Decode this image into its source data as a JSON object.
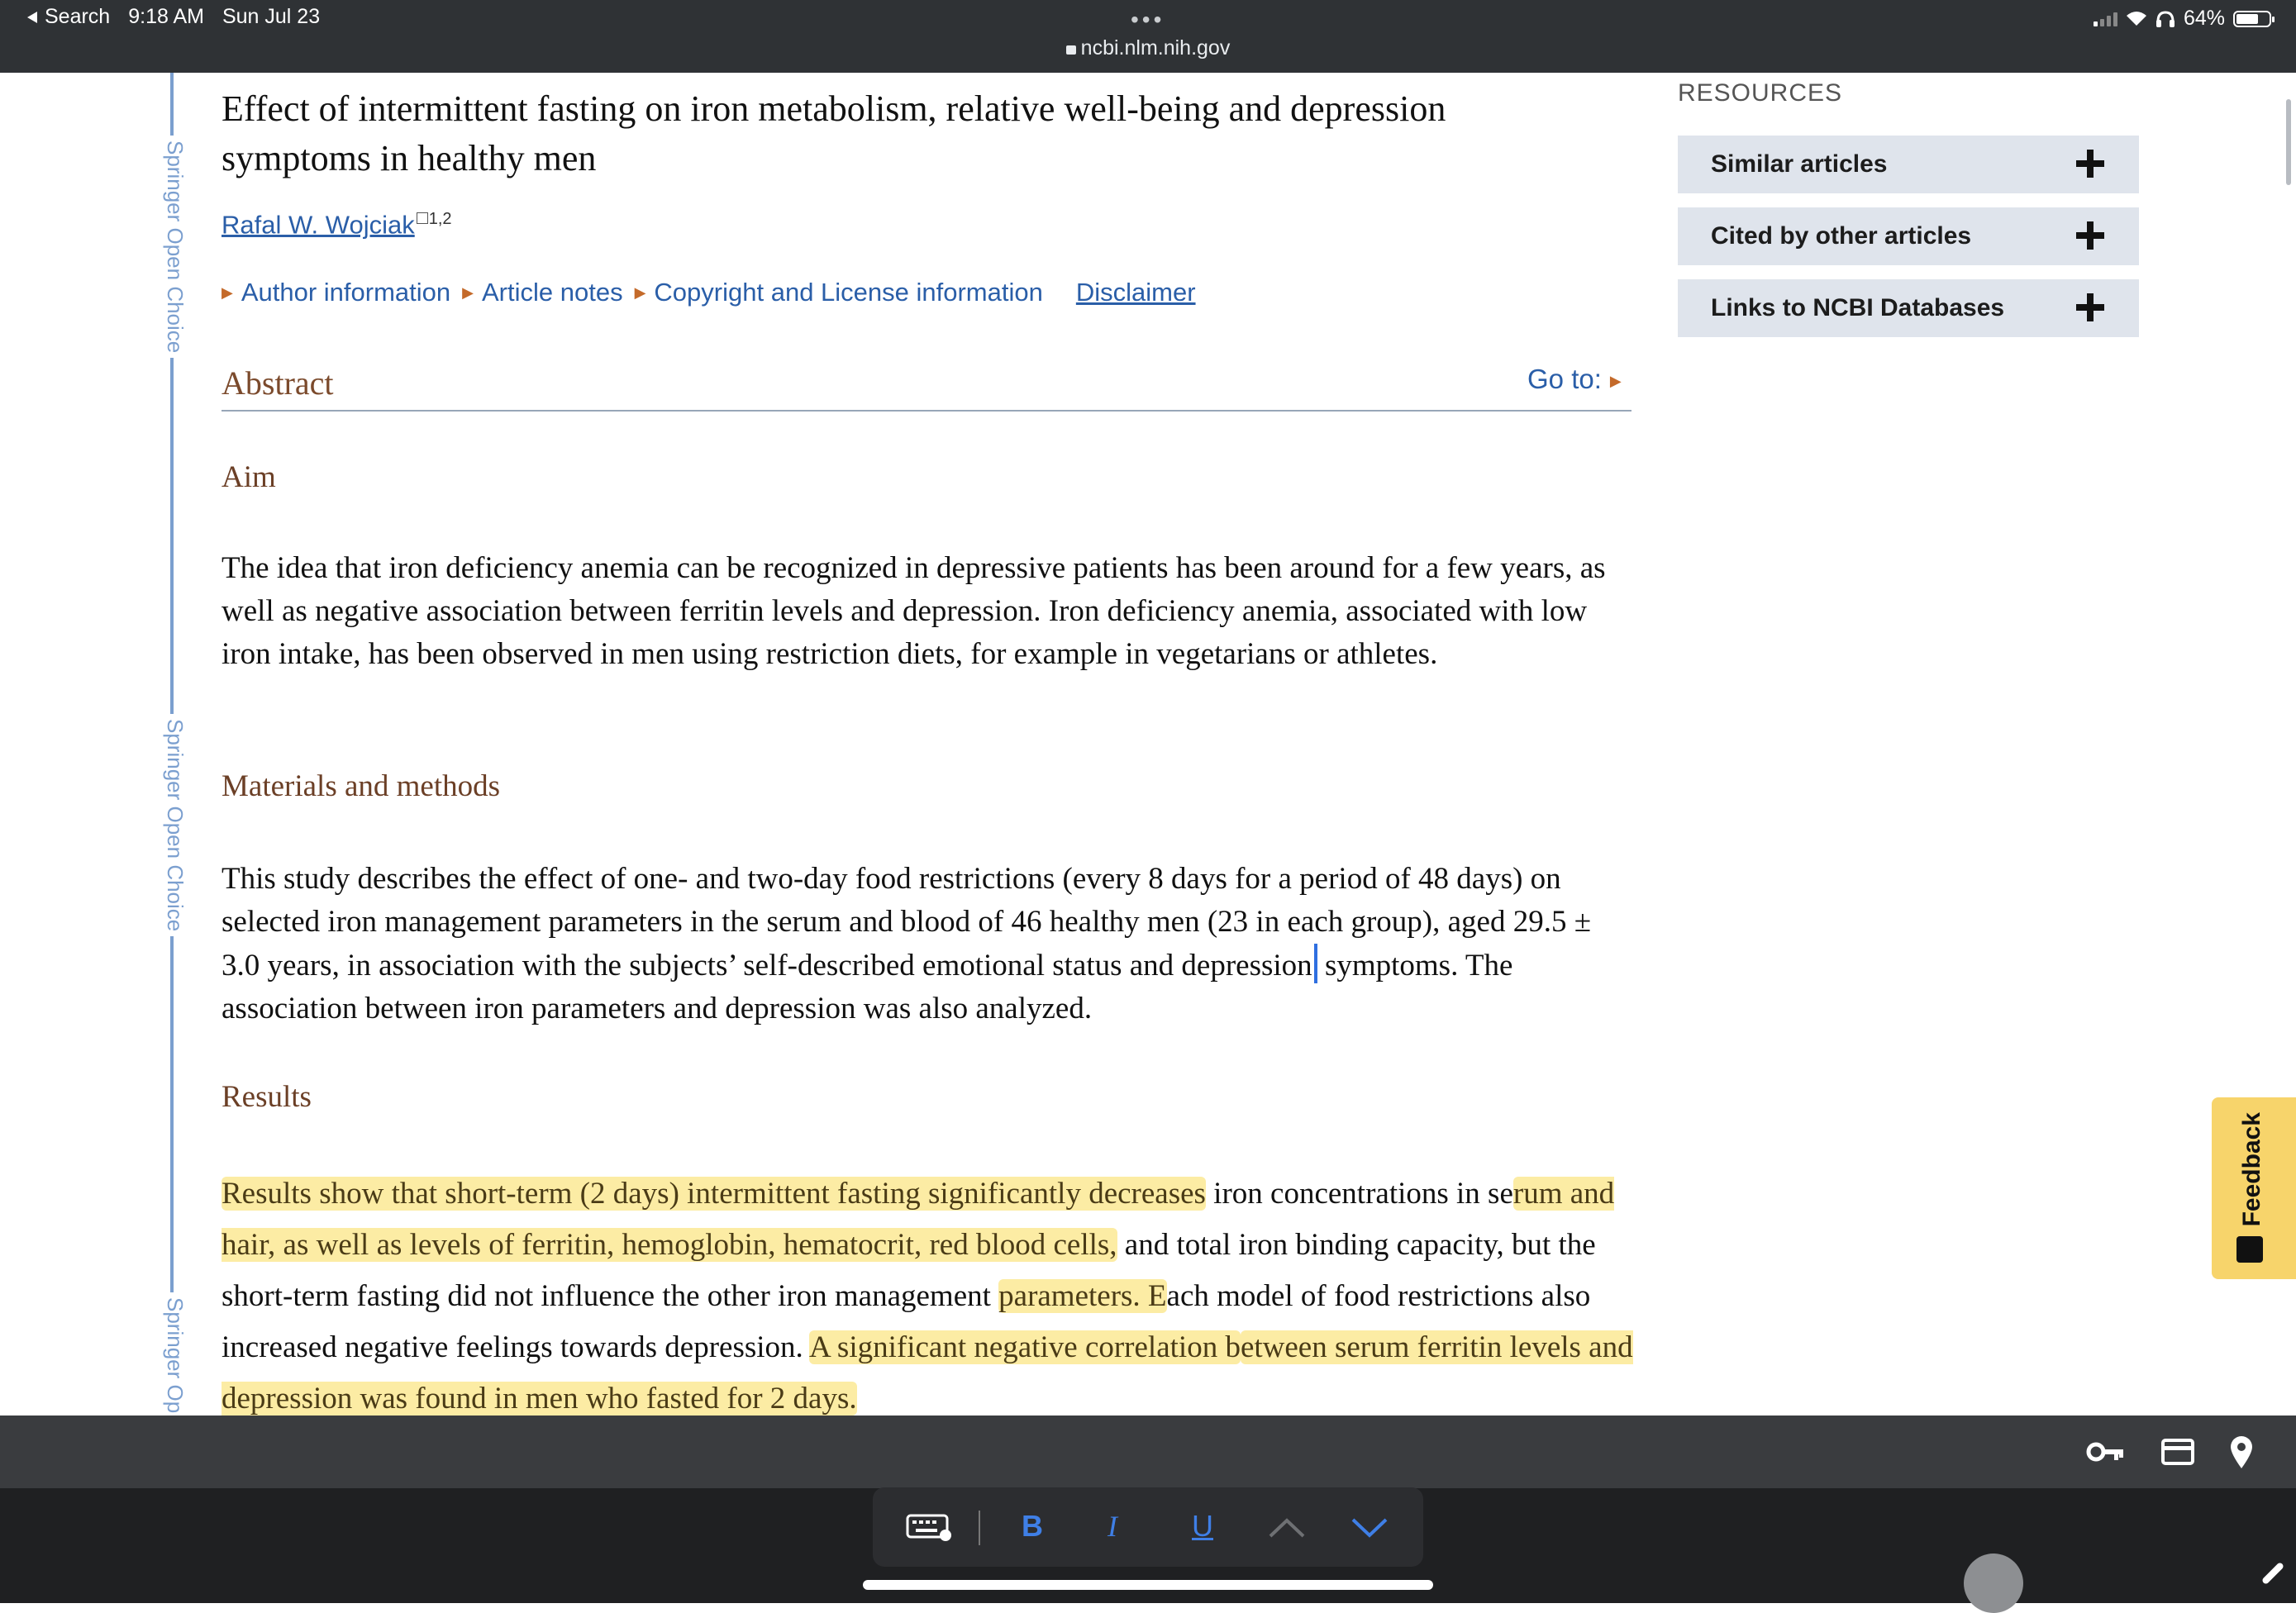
{
  "status_bar": {
    "back_label": "Search",
    "time": "9:18 AM",
    "date": "Sun Jul 23",
    "url": "ncbi.nlm.nih.gov",
    "battery": "64%",
    "battery_level": 0.64
  },
  "sidebar_label": "Springer Open Choice",
  "sidebar_label_cut": "Springer Op",
  "article": {
    "title_line1": "Effect of intermittent fasting on iron metabolism, relative well-being and depression",
    "title_line2": "symptoms in healthy men",
    "author": "Rafal W. Wojciak",
    "author_sup": "1,2",
    "links": [
      "Author information",
      "Article notes",
      "Copyright and License information"
    ],
    "disclaimer": "Disclaimer",
    "abstract_heading": "Abstract",
    "goto": "Go to:",
    "aim_heading": "Aim",
    "aim_text": "The idea that iron deficiency anemia can be recognized in depressive patients has been around for a few years, as well as negative association between ferritin levels and depression. Iron deficiency anemia, associated with low iron intake, has been observed in men using restriction diets, for example in vegetarians or athletes.",
    "methods_heading": "Materials and methods",
    "methods_text": "This study describes the effect of one- and two-day food restrictions (every 8 days for a period of 48 days) on selected iron management parameters in the serum and blood of 46 healthy men (23 in each group), aged 29.5 ± 3.0 years, in association with the subjects’ self-described emotional status and depression",
    "methods_text_end": "symptoms. The association between iron parameters and depression was also analyzed.",
    "results_heading": "Results",
    "results_hl1": "Results show that short-term (2 days) intermittent fasting significantly decreases",
    "results_p1": " iron concentrations in se",
    "results_hl2": "rum and hair, as well as levels of ferritin, hemoglobin, hematocrit, red blood cells,",
    "results_p2": " and total iron binding capacity, but the short-term fasting did not influence the other iron management ",
    "results_hl3": "parameters. E",
    "results_p3": "ach model of food restrictions also increased negative feelings towards depression. ",
    "results_hl4": "A significant negative correlation b",
    "results_hl5": "etween serum ferritin levels and depression was found in men who fasted for 2 days."
  },
  "resources": {
    "title": "RESOURCES",
    "items": [
      "Similar articles",
      "Cited by other articles",
      "Links to NCBI Databases"
    ]
  },
  "feedback_label": "Feedback",
  "format_bar": {
    "bold": "B",
    "italic": "I",
    "underline": "U"
  },
  "colors": {
    "link": "#2a5ea8",
    "heading": "#7b4a2c",
    "highlight": "#fadc5a",
    "sidebar_line": "#7b9fcf"
  }
}
